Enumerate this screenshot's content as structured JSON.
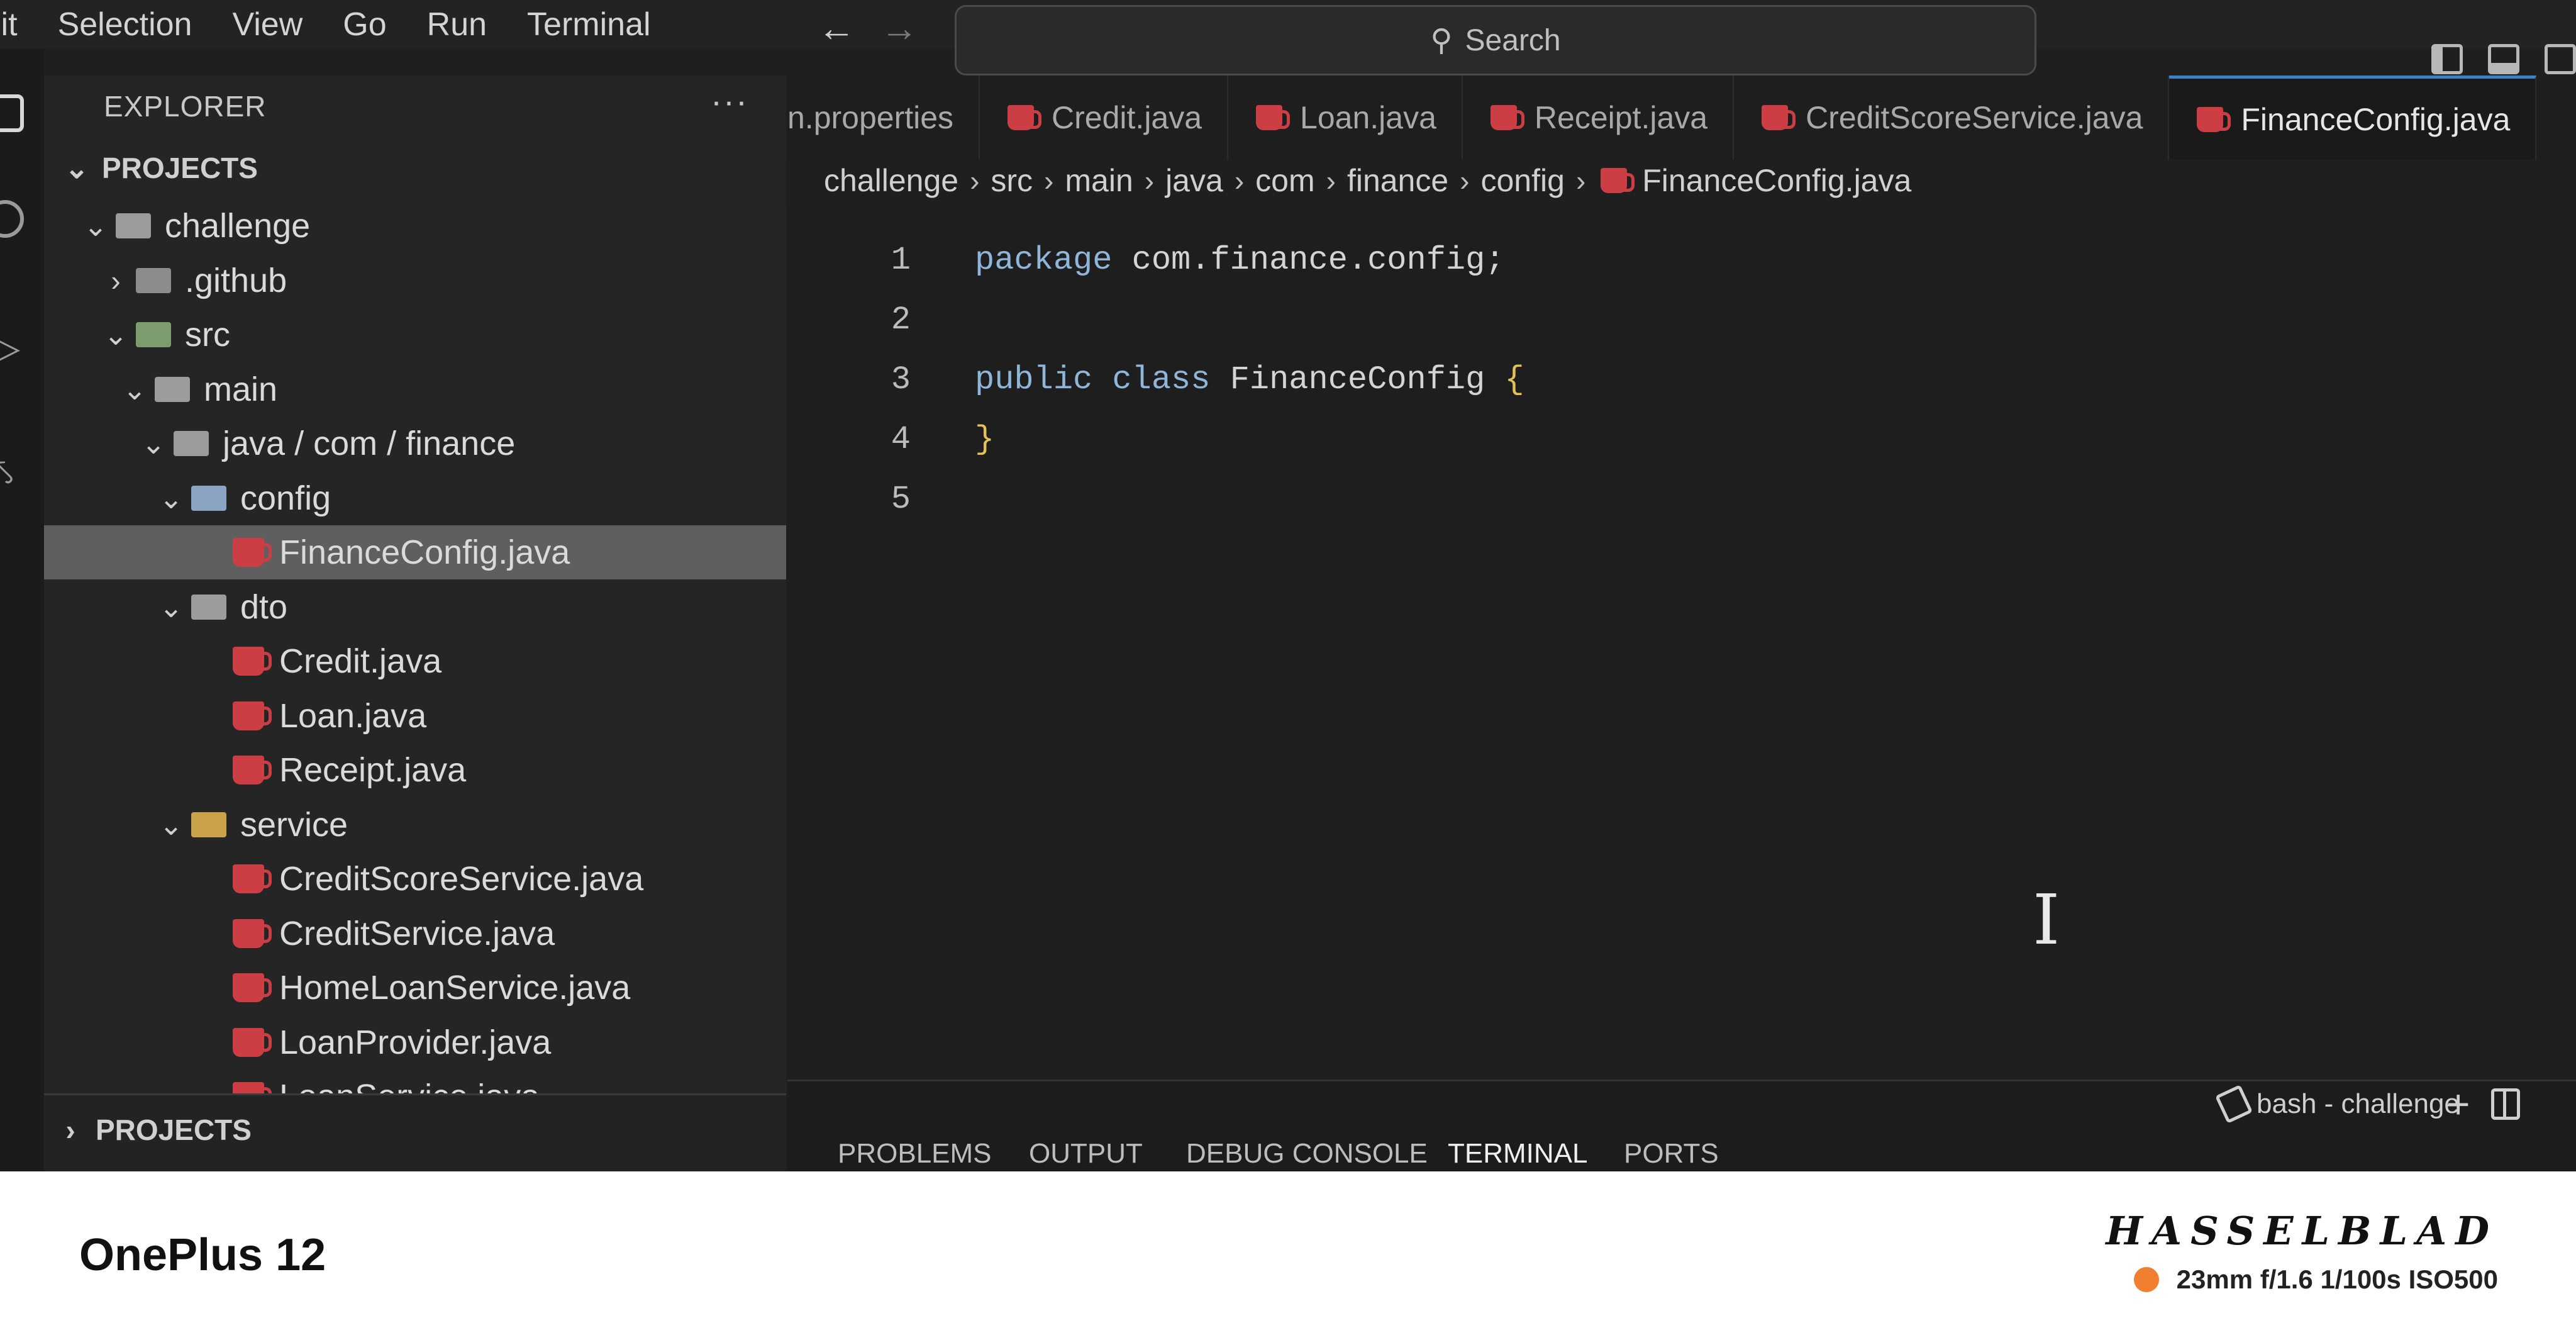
{
  "menu": [
    "lit",
    "Selection",
    "View",
    "Go",
    "Run",
    "Terminal"
  ],
  "search": {
    "label": "Search"
  },
  "sidebar": {
    "header": "EXPLORER",
    "more": "···",
    "section_top": "PROJECTS",
    "section_bottom": "PROJECTS",
    "tree": [
      {
        "label": "challenge",
        "type": "folder",
        "depth": 1,
        "expanded": true
      },
      {
        "label": ".github",
        "type": "folder-github",
        "depth": 2,
        "expanded": false
      },
      {
        "label": "src",
        "type": "folder-src",
        "depth": 2,
        "expanded": true
      },
      {
        "label": "main",
        "type": "folder",
        "depth": 3,
        "expanded": true
      },
      {
        "label": "java / com / finance",
        "type": "folder",
        "depth": 4,
        "expanded": true
      },
      {
        "label": "config",
        "type": "folder-config",
        "depth": 5,
        "expanded": true
      },
      {
        "label": "FinanceConfig.java",
        "type": "java",
        "depth": 6,
        "selected": true
      },
      {
        "label": "dto",
        "type": "folder",
        "depth": 5,
        "expanded": true
      },
      {
        "label": "Credit.java",
        "type": "java",
        "depth": 6
      },
      {
        "label": "Loan.java",
        "type": "java",
        "depth": 6
      },
      {
        "label": "Receipt.java",
        "type": "java",
        "depth": 6
      },
      {
        "label": "service",
        "type": "folder-service",
        "depth": 5,
        "expanded": true
      },
      {
        "label": "CreditScoreService.java",
        "type": "java",
        "depth": 6
      },
      {
        "label": "CreditService.java",
        "type": "java",
        "depth": 6
      },
      {
        "label": "HomeLoanService.java",
        "type": "java",
        "depth": 6
      },
      {
        "label": "LoanProvider.java",
        "type": "java",
        "depth": 6
      },
      {
        "label": "LoanService.java",
        "type": "java",
        "depth": 6
      }
    ]
  },
  "tabs": [
    {
      "label": "n.properties",
      "icon": false
    },
    {
      "label": "Credit.java",
      "icon": true
    },
    {
      "label": "Loan.java",
      "icon": true
    },
    {
      "label": "Receipt.java",
      "icon": true
    },
    {
      "label": "CreditScoreService.java",
      "icon": true
    },
    {
      "label": "FinanceConfig.java",
      "icon": true,
      "active": true
    }
  ],
  "breadcrumb": [
    "challenge",
    "src",
    "main",
    "java",
    "com",
    "finance",
    "config",
    "FinanceConfig.java"
  ],
  "editor": {
    "lines": [
      {
        "num": "1",
        "keyword": "package",
        "text": " com.finance.config;"
      },
      {
        "num": "2",
        "keyword": "",
        "text": ""
      },
      {
        "num": "3",
        "keyword": "public class",
        "text": " FinanceConfig ",
        "brace": "{"
      },
      {
        "num": "4",
        "keyword": "",
        "text": "",
        "brace": "}"
      },
      {
        "num": "5",
        "keyword": "",
        "text": ""
      }
    ]
  },
  "panel": {
    "tabs": [
      "PROBLEMS",
      "OUTPUT",
      "DEBUG CONSOLE",
      "TERMINAL",
      "PORTS"
    ],
    "active_tab": "TERMINAL",
    "terminal_name": "bash - challenge"
  },
  "footer": {
    "device": "OnePlus 12",
    "brand": "HASSELBLAD",
    "exif": "23mm  f/1.6  1/100s  ISO500",
    "dot_color": "#f08030"
  }
}
